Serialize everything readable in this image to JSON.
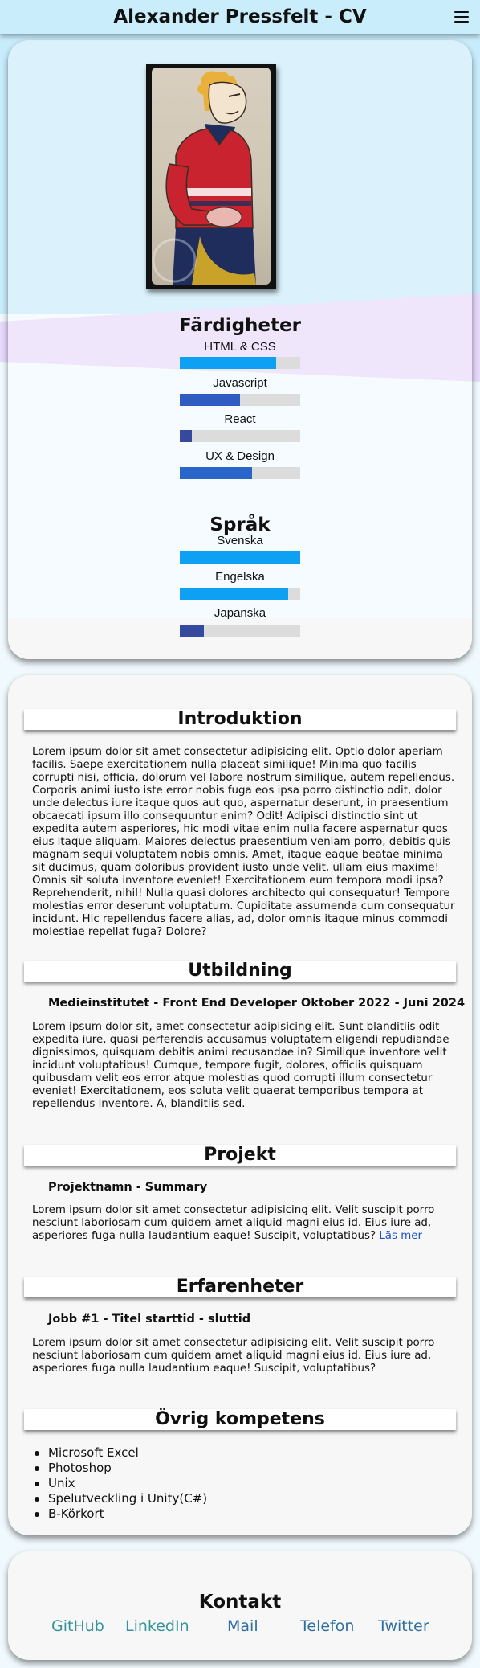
{
  "header": {
    "title": "Alexander Pressfelt - CV"
  },
  "skills": {
    "title": "Färdigheter",
    "items": [
      {
        "label": "HTML & CSS",
        "level": 0.8,
        "color": "#0ea0f2"
      },
      {
        "label": "Javascript",
        "level": 0.5,
        "color": "#2f5cc2"
      },
      {
        "label": "React",
        "level": 0.1,
        "color": "#354a9e"
      },
      {
        "label": "UX & Design",
        "level": 0.6,
        "color": "#2a66c9"
      }
    ]
  },
  "languages": {
    "title": "Språk",
    "items": [
      {
        "label": "Svenska",
        "level": 1.0,
        "color": "#0ea0f2"
      },
      {
        "label": "Engelska",
        "level": 0.9,
        "color": "#0ea0f2"
      },
      {
        "label": "Japanska",
        "level": 0.2,
        "color": "#354a9e"
      }
    ]
  },
  "intro": {
    "title": "Introduktion",
    "text": "Lorem ipsum dolor sit amet consectetur adipisicing elit. Optio dolor aperiam facilis. Saepe exercitationem nulla placeat similique! Minima quo facilis corrupti nisi, officia, dolorum vel labore nostrum similique, autem repellendus. Corporis animi iusto iste error nobis fuga eos ipsa porro distinctio odit, dolor unde delectus iure itaque quos aut quo, aspernatur deserunt, in praesentium obcaecati ipsum illo consequuntur enim? Odit! Adipisci distinctio sint ut expedita autem asperiores, hic modi vitae enim nulla facere aspernatur quos eius itaque aliquam. Maiores delectus praesentium veniam porro, debitis quis magnam sequi voluptatem nobis omnis. Amet, itaque eaque beatae minima sit ducimus, quam doloribus provident iusto unde velit, ullam eius maxime! Omnis sit soluta inventore eveniet! Exercitationem eum tempora modi ipsa? Reprehenderit, nihil! Nulla quasi dolores architecto qui consequatur! Tempore molestias error deserunt voluptatum. Cupiditate assumenda cum consequatur incidunt. Hic repellendus facere alias, ad, dolor omnis itaque minus commodi molestiae repellat fuga? Dolore?"
  },
  "education": {
    "title": "Utbildning",
    "entry_title": "Medieinstitutet - Front End Developer Oktober 2022 - Juni 2024",
    "text": "Lorem ipsum dolor sit, amet consectetur adipisicing elit. Sunt blanditiis odit expedita iure, quasi perferendis accusamus voluptatem eligendi repudiandae dignissimos, quisquam debitis animi recusandae in? Similique inventore velit incidunt voluptatibus! Cumque, tempore fugit, dolores, officiis quisquam quibusdam velit eos error atque molestias quod corrupti illum consectetur eveniet! Exercitationem, eos soluta velit quaerat temporibus tempora at repellendus inventore. A, blanditiis sed."
  },
  "projects": {
    "title": "Projekt",
    "entry_title": "Projektnamn - Summary",
    "text": "Lorem ipsum dolor sit amet consectetur adipisicing elit. Velit suscipit porro nesciunt laboriosam cum quidem amet aliquid magni eius id. Eius iure ad, asperiores fuga nulla laudantium eaque! Suscipit, voluptatibus?",
    "more_link": "Läs mer"
  },
  "experience": {
    "title": "Erfarenheter",
    "entry_title": "Jobb #1 - Titel starttid - sluttid",
    "text": "Lorem ipsum dolor sit amet consectetur adipisicing elit. Velit suscipit porro nesciunt laboriosam cum quidem amet aliquid magni eius id. Eius iure ad, asperiores fuga nulla laudantium eaque! Suscipit, voluptatibus?"
  },
  "competence": {
    "title": "Övrig kompetens",
    "items": [
      "Microsoft Excel",
      "Photoshop",
      "Unix",
      "Spelutveckling i Unity(C#)",
      "B-Körkort"
    ]
  },
  "contact": {
    "title": "Kontakt",
    "links": [
      {
        "label": "GitHub",
        "color": "#35949b"
      },
      {
        "label": "LinkedIn",
        "color": "#35949b"
      },
      {
        "label": "Mail",
        "color": "#2f6fa0"
      },
      {
        "label": "Telefon",
        "color": "#2f6fa0"
      },
      {
        "label": "Twitter",
        "color": "#2f6fa0"
      }
    ]
  }
}
